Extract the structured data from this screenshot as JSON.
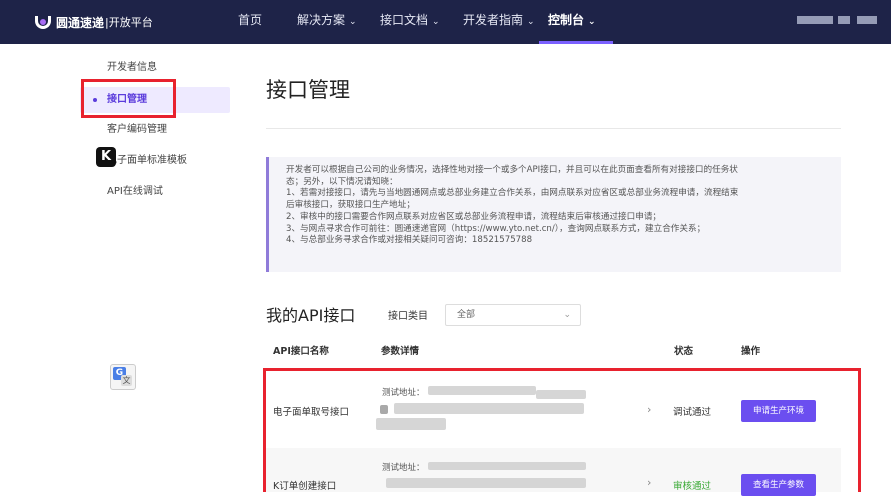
{
  "header": {
    "logo_text": "圆通速递",
    "logo_sub": "|开放平台",
    "nav": [
      {
        "label": "首页",
        "has_menu": false
      },
      {
        "label": "解决方案",
        "has_menu": true
      },
      {
        "label": "接口文档",
        "has_menu": true
      },
      {
        "label": "开发者指南",
        "has_menu": true
      },
      {
        "label": "控制台",
        "has_menu": true,
        "active": true
      }
    ],
    "chevron": "⌄"
  },
  "sidebar": {
    "items": [
      {
        "label": "开发者信息"
      },
      {
        "label": "接口管理",
        "active": true
      },
      {
        "label": "客户编码管理"
      },
      {
        "label": "电子面单标准模板"
      },
      {
        "label": "API在线调试"
      }
    ]
  },
  "main": {
    "title": "接口管理",
    "notice_lines": [
      "开发者可以根据自己公司的业务情况，选择性地对接一个或多个API接口，并且可以在此页面查看所有对接接口的任务状",
      "态；另外，以下情况请知晓：",
      "1、若需对接接口，请先与当地圆通网点或总部业务建立合作关系，由网点联系对应省区或总部业务流程申请，流程结束",
      "后审核接口，获取接口生产地址；",
      "2、审核中的接口需要合作网点联系对应省区或总部业务流程申请，流程结束后审核通过接口申请；",
      "3、与网点寻求合作可前往：圆通速递官网（https://www.yto.net.cn/），查询网点联系方式，建立合作关系；",
      "4、与总部业务寻求合作或对接相关疑问可咨询：18521575788"
    ],
    "section_title": "我的API接口",
    "filter_label": "接口类目",
    "filter_value": "全部",
    "table_headers": [
      "API接口名称",
      "参数详情",
      "状态",
      "操作"
    ],
    "rows": [
      {
        "name": "电子面单取号接口",
        "param_label": "测试地址：",
        "status": "调试通过",
        "action": "申请生产环境"
      },
      {
        "name": "K订单创建接口",
        "param_label": "测试地址：",
        "status": "审核通过",
        "action": "查看生产参数"
      }
    ]
  },
  "overlays": {
    "k_badge": "K",
    "translate_icon": "translate-icon"
  },
  "colors": {
    "header_bg": "#1e2348",
    "accent": "#6b4ef0",
    "highlight_red": "#e8222e",
    "status_green": "#3aa935"
  }
}
